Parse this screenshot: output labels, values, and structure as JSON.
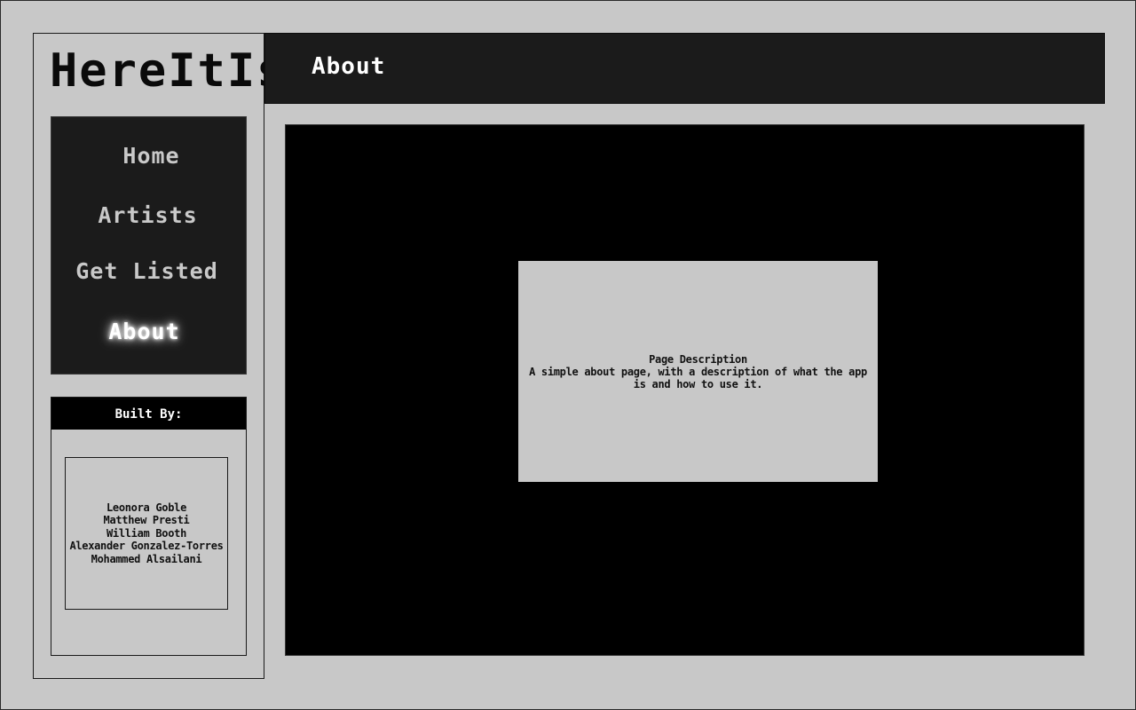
{
  "app": {
    "logo": "HereItIs"
  },
  "nav": {
    "items": [
      {
        "label": "Home"
      },
      {
        "label": "Artists"
      },
      {
        "label": "Get Listed"
      },
      {
        "label": "About",
        "active": true
      }
    ]
  },
  "credits": {
    "title": "Built By:",
    "names": [
      "Leonora Goble",
      "Matthew Presti",
      "William Booth",
      "Alexander Gonzalez-Torres",
      "Mohammed Alsailani"
    ]
  },
  "header": {
    "title": "About"
  },
  "main": {
    "card_title": "Page Description",
    "card_text": "A simple about page, with a description of what the app is and how to use it."
  },
  "colors": {
    "background": "#c8c8c8",
    "panel_dark": "#1b1b1b",
    "content_bg": "#000000",
    "nav_text": "#c9c9c9",
    "active_text": "#ffffff"
  }
}
